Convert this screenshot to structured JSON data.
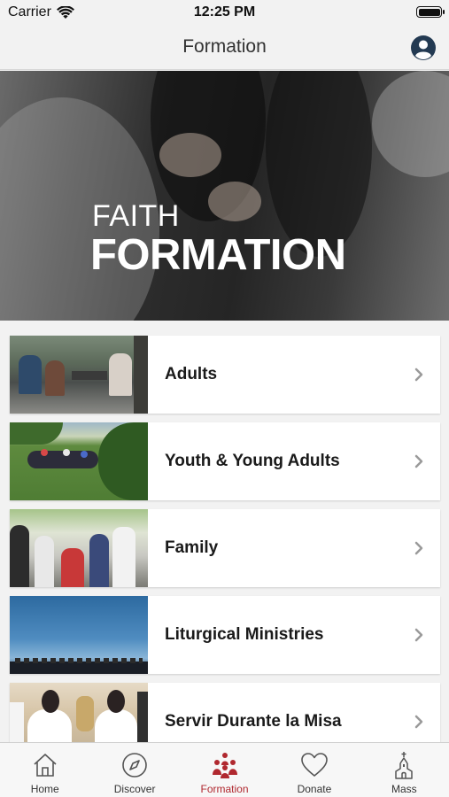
{
  "status_bar": {
    "carrier": "Carrier",
    "time": "12:25 PM"
  },
  "nav": {
    "title": "Formation"
  },
  "hero": {
    "line1": "FAITH",
    "line2": "FORMATION"
  },
  "items": [
    {
      "label": "Adults"
    },
    {
      "label": "Youth & Young Adults"
    },
    {
      "label": "Family"
    },
    {
      "label": "Liturgical Ministries"
    },
    {
      "label": "Servir Durante la Misa"
    }
  ],
  "tabs": [
    {
      "label": "Home",
      "icon": "home-icon"
    },
    {
      "label": "Discover",
      "icon": "compass-icon"
    },
    {
      "label": "Formation",
      "icon": "people-icon"
    },
    {
      "label": "Donate",
      "icon": "heart-icon"
    },
    {
      "label": "Mass",
      "icon": "church-icon"
    }
  ],
  "colors": {
    "accent": "#b0282f",
    "background": "#f2f2f2"
  }
}
